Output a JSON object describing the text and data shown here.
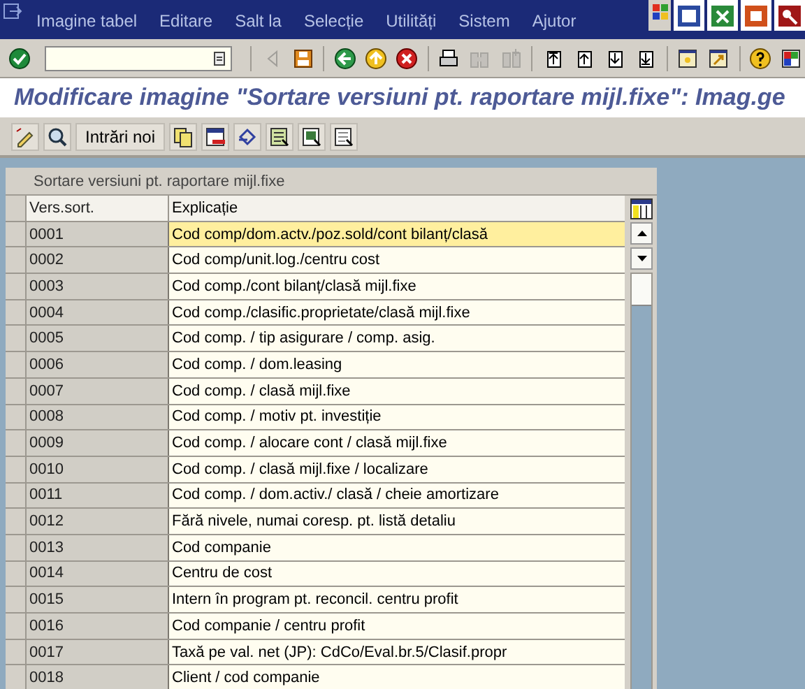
{
  "menu": [
    {
      "label": "Imagine tabel"
    },
    {
      "label": "Editare"
    },
    {
      "label": "Salt la"
    },
    {
      "label": "Selecție"
    },
    {
      "label": "Utilități"
    },
    {
      "label": "Sistem"
    },
    {
      "label": "Ajutor"
    }
  ],
  "toolbar": [
    {
      "kind": "enter",
      "disabled": false
    },
    {
      "kind": "command"
    },
    {
      "kind": "sep"
    },
    {
      "kind": "triangle",
      "disabled": true
    },
    {
      "kind": "save",
      "disabled": false
    },
    {
      "kind": "sep"
    },
    {
      "kind": "back",
      "disabled": false
    },
    {
      "kind": "exit",
      "disabled": false
    },
    {
      "kind": "cancel",
      "disabled": false
    },
    {
      "kind": "sep"
    },
    {
      "kind": "print",
      "disabled": false
    },
    {
      "kind": "find",
      "disabled": true
    },
    {
      "kind": "findnext",
      "disabled": true
    },
    {
      "kind": "sep"
    },
    {
      "kind": "first",
      "disabled": false
    },
    {
      "kind": "prev",
      "disabled": false
    },
    {
      "kind": "next",
      "disabled": false
    },
    {
      "kind": "last",
      "disabled": false
    },
    {
      "kind": "sep"
    },
    {
      "kind": "session",
      "disabled": false
    },
    {
      "kind": "shortcut",
      "disabled": false
    },
    {
      "kind": "sep"
    },
    {
      "kind": "help",
      "disabled": false
    },
    {
      "kind": "layout",
      "disabled": false
    }
  ],
  "title": "Modificare imagine \"Sortare versiuni pt. raportare mijl.fixe\": Imag.ge",
  "app_toolbar": [
    {
      "kind": "edit"
    },
    {
      "kind": "details"
    },
    {
      "kind": "text",
      "label": "Intrări noi"
    },
    {
      "kind": "copy"
    },
    {
      "kind": "delete"
    },
    {
      "kind": "undo"
    },
    {
      "kind": "selectall"
    },
    {
      "kind": "selectblock"
    },
    {
      "kind": "deselect"
    }
  ],
  "table": {
    "title": "Sortare versiuni pt. raportare mijl.fixe",
    "columns": [
      "Vers.sort.",
      "Explicație"
    ],
    "rows": [
      {
        "key": "0001",
        "text": "Cod comp/dom.actv./poz.sold/cont bilanț/clasă",
        "selected": true
      },
      {
        "key": "0002",
        "text": "Cod comp/unit.log./centru cost",
        "selected": false
      },
      {
        "key": "0003",
        "text": "Cod comp./cont bilanț/clasă mijl.fixe",
        "selected": false
      },
      {
        "key": "0004",
        "text": "Cod comp./clasific.proprietate/clasă mijl.fixe",
        "selected": false
      },
      {
        "key": "0005",
        "text": "Cod comp. / tip asigurare / comp. asig.",
        "selected": false
      },
      {
        "key": "0006",
        "text": "Cod comp. / dom.leasing",
        "selected": false
      },
      {
        "key": "0007",
        "text": "Cod comp. / clasă mijl.fixe",
        "selected": false
      },
      {
        "key": "0008",
        "text": "Cod comp. / motiv pt. investiție",
        "selected": false
      },
      {
        "key": "0009",
        "text": "Cod comp. / alocare cont / clasă mijl.fixe",
        "selected": false
      },
      {
        "key": "0010",
        "text": "Cod comp. / clasă mijl.fixe / localizare",
        "selected": false
      },
      {
        "key": "0011",
        "text": "Cod comp. / dom.activ./ clasă / cheie amortizare",
        "selected": false
      },
      {
        "key": "0012",
        "text": "Fără nivele, numai coresp. pt. listă detaliu",
        "selected": false
      },
      {
        "key": "0013",
        "text": "Cod companie",
        "selected": false
      },
      {
        "key": "0014",
        "text": "Centru de cost",
        "selected": false
      },
      {
        "key": "0015",
        "text": "Intern în program pt. reconcil. centru profit",
        "selected": false
      },
      {
        "key": "0016",
        "text": "Cod companie / centru profit",
        "selected": false
      },
      {
        "key": "0017",
        "text": "Taxă pe val. net (JP): CdCo/Eval.br.5/Clasif.propr",
        "selected": false
      },
      {
        "key": "0018",
        "text": "Client / cod companie",
        "selected": false
      }
    ]
  }
}
